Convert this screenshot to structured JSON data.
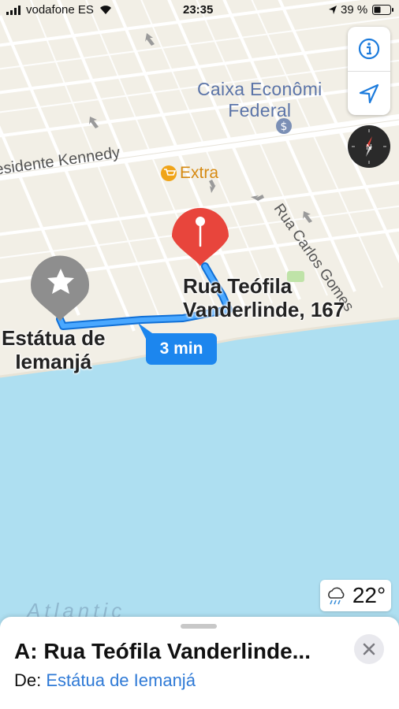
{
  "status_bar": {
    "carrier": "vodafone ES",
    "time": "23:35",
    "battery": "39 %"
  },
  "map": {
    "poi_bank": {
      "line1": "Caixa Econômi",
      "line2": "Federal"
    },
    "street_kennedy": "esidente Kennedy",
    "street_carlos": "Rua Carlos Gomes",
    "poi_extra": "Extra",
    "destination": {
      "line1": "Rua Teófila",
      "line2": "Vanderlinde, 167"
    },
    "origin": {
      "line1": "Estátua de",
      "line2": "Iemanjá"
    },
    "route_time": "3 min",
    "ocean": "Atlantic"
  },
  "controls": {
    "info_icon": "info-icon",
    "location_icon": "location-arrow-icon",
    "compass_icon": "compass-icon"
  },
  "weather": {
    "temp": "22°",
    "icon": "rain-cloud-icon"
  },
  "sheet": {
    "title": "A: Rua Teófila Vanderlinde...",
    "from_prefix": "De: ",
    "from_place": "Estátua de Iemanjá"
  },
  "colors": {
    "route": "#1c86ee",
    "pin_red": "#e8453c",
    "pin_gray": "#8e8e8e",
    "water": "#aedff1",
    "land": "#f2efe6"
  }
}
